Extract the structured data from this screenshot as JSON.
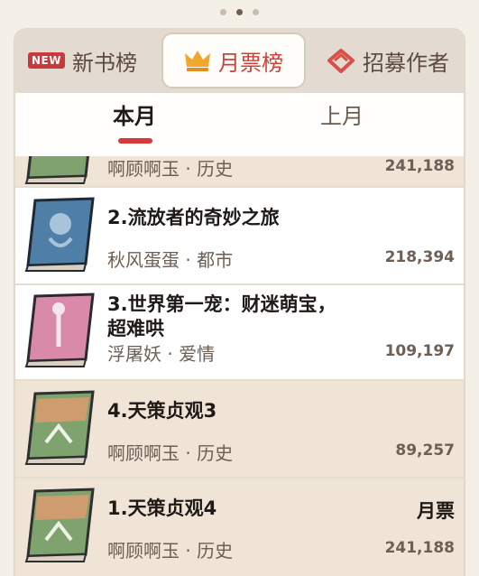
{
  "pager": {
    "dots": 3,
    "active": 1
  },
  "tabs": {
    "new_badge": "NEW",
    "new_books": "新书榜",
    "monthly": "月票榜",
    "recruit": "招募作者"
  },
  "subtabs": {
    "current": "本月",
    "previous": "上月"
  },
  "list": {
    "partial_top": {
      "meta": "啊顾啊玉 · 历史",
      "votes": "241,188"
    },
    "items": [
      {
        "title": "2.流放者的奇妙之旅",
        "meta": "秋风蛋蛋 · 都市",
        "votes": "218,394"
      },
      {
        "title": "3.世界第一宠：财迷萌宝，超难哄",
        "meta": "浮屠妖 · 爱情",
        "votes": "109,197"
      },
      {
        "title": "4.天策贞观3",
        "meta": "啊顾啊玉 · 历史",
        "votes": "89,257"
      },
      {
        "title": "1.天策贞观4",
        "meta": "啊顾啊玉 · 历史",
        "votes": "241,188",
        "tag": "月票"
      }
    ]
  },
  "colors": {
    "accent": "#d8393a",
    "highlight_row": "#efe4d6",
    "badge": "#c9383a"
  }
}
